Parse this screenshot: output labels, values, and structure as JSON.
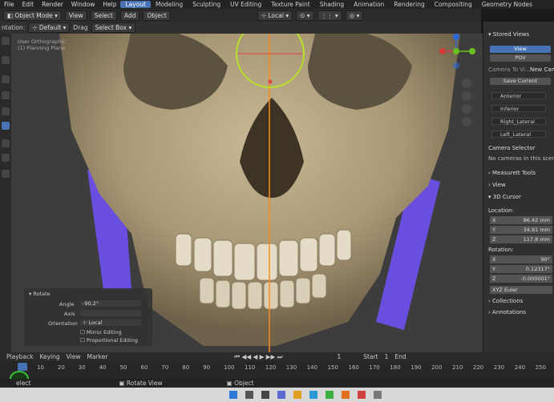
{
  "menu": [
    "File",
    "Edit",
    "Render",
    "Window",
    "Help"
  ],
  "workspaces": [
    {
      "label": "Layout",
      "active": true
    },
    {
      "label": "Modeling",
      "active": false
    },
    {
      "label": "Sculpting",
      "active": false
    },
    {
      "label": "UV Editing",
      "active": false
    },
    {
      "label": "Texture Paint",
      "active": false
    },
    {
      "label": "Shading",
      "active": false
    },
    {
      "label": "Animation",
      "active": false
    },
    {
      "label": "Rendering",
      "active": false
    },
    {
      "label": "Compositing",
      "active": false
    },
    {
      "label": "Geometry Nodes",
      "active": false
    }
  ],
  "header": {
    "mode": "Object Mode",
    "view": "View",
    "select": "Select",
    "add": "Add",
    "object": "Object",
    "transform_orientation": "Local"
  },
  "tool_header": {
    "orientation_label": "ntation:",
    "orientation_value": "Default",
    "drag_label": "Drag",
    "drag_value": "Select Box"
  },
  "viewport": {
    "overlay_line1": "User Orthographic",
    "overlay_line2": "(1) Planning Plane"
  },
  "npanel": {
    "stored_views": "Stored Views",
    "tab_view": "View",
    "tab_pov": "POV",
    "camera_to_view": "Camera To Vi...",
    "new_cam": "New Cam",
    "save_current": "Save Current",
    "views": [
      "Anterior",
      "Inferior",
      "Right_Lateral",
      "Left_Lateral"
    ],
    "camera_selector": "Camera Selector",
    "no_cameras": "No cameras in this scene",
    "measureit": "MeasureIt Tools",
    "view_section": "View",
    "cursor_section": "3D Cursor",
    "location_label": "Location:",
    "location": [
      {
        "axis": "X",
        "value": "86.42 mm"
      },
      {
        "axis": "Y",
        "value": "34.91 mm"
      },
      {
        "axis": "Z",
        "value": "117.8 mm"
      }
    ],
    "rotation_label": "Rotation:",
    "rotation": [
      {
        "axis": "X",
        "value": "90°"
      },
      {
        "axis": "Y",
        "value": "0.12317°"
      },
      {
        "axis": "Z",
        "value": "-0.000001°"
      }
    ],
    "rotation_mode": "XYZ Euler",
    "collections": "Collections",
    "annotations": "Annotations"
  },
  "operator_panel": {
    "title": "Rotate",
    "angle_label": "Angle",
    "angle_value": "-90.2°",
    "axis_label": "Axis",
    "orientation_label": "Orientation",
    "orientation_value": "Local",
    "mirror": "Mirror Editing",
    "proportional": "Proportional Editing"
  },
  "timeline": {
    "playback": "Playback",
    "keying": "Keying",
    "view": "View",
    "marker": "Marker",
    "current_frame": "1",
    "start_label": "Start",
    "start_value": "1",
    "end_label": "End",
    "frames": [
      "10",
      "20",
      "30",
      "40",
      "50",
      "60",
      "70",
      "80",
      "90",
      "100",
      "110",
      "120",
      "130",
      "140",
      "150",
      "160",
      "170",
      "180",
      "190",
      "200",
      "210",
      "220",
      "230",
      "240",
      "250"
    ]
  },
  "statusbar": {
    "select": "elect",
    "rotate_view": "Rotate View",
    "object": "Object"
  }
}
